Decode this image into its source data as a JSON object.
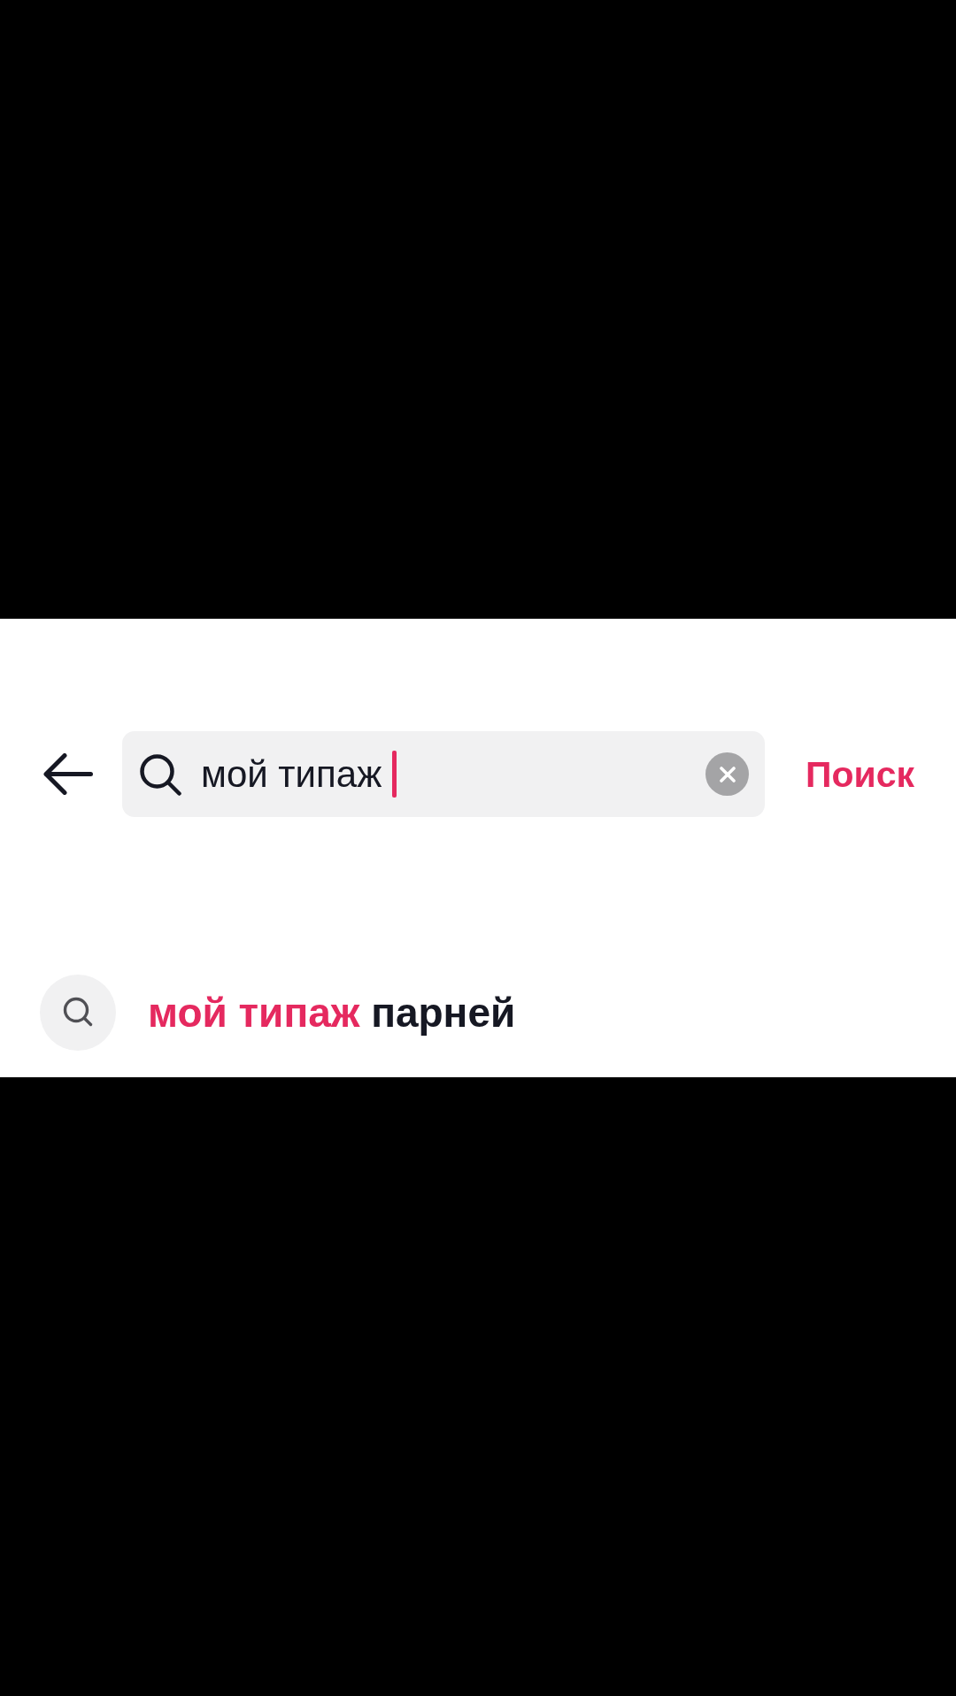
{
  "search_bar": {
    "value": "мой типаж",
    "focused": true
  },
  "search_button": {
    "label": "Поиск"
  },
  "suggestions": [
    {
      "matched": "мой типаж",
      "completion": "парней"
    }
  ]
}
